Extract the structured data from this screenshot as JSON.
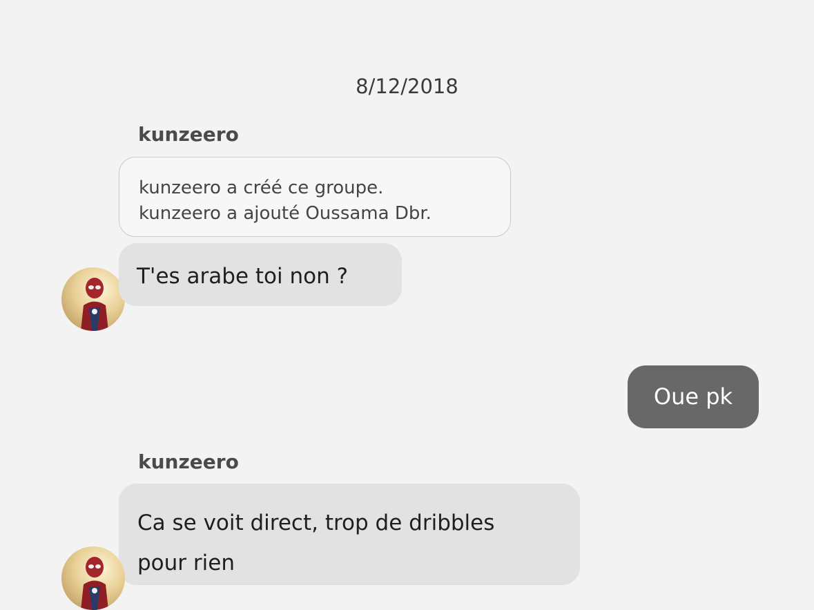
{
  "chat": {
    "date": "8/12/2018",
    "groups": [
      {
        "sender": "kunzeero",
        "system_lines": [
          "kunzeero a créé ce groupe.",
          "kunzeero a ajouté Oussama Dbr."
        ],
        "message": "T'es arabe toi non ?"
      },
      {
        "sender": "kunzeero",
        "message_lines": [
          "Ca se voit direct, trop de dribbles",
          "pour rien"
        ]
      }
    ],
    "outgoing_message": "Oue pk"
  },
  "colors": {
    "background": "#f3f3f3",
    "incoming_bubble": "#e2e2e2",
    "outgoing_bubble": "#686868",
    "outgoing_text": "#ffffff"
  },
  "icons": {
    "avatar": "spider-man-avatar-icon"
  }
}
